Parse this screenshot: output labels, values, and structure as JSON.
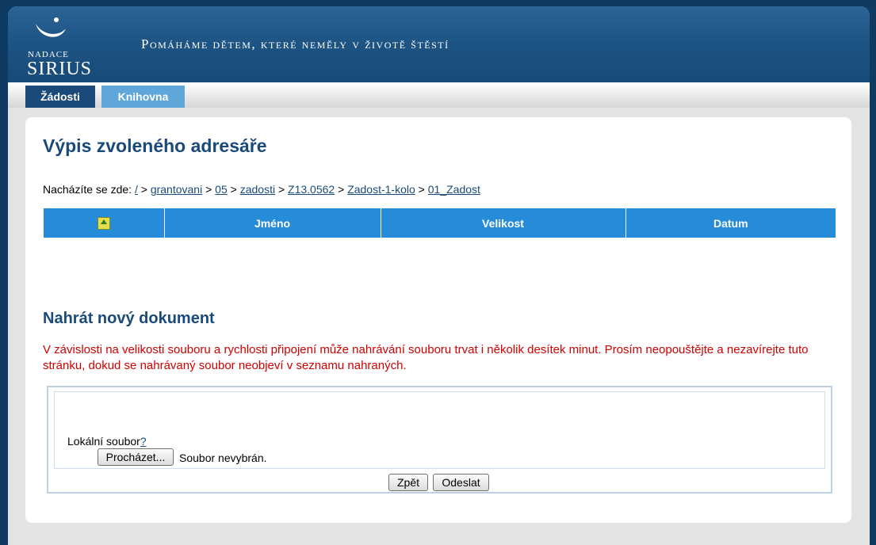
{
  "brand": {
    "logo_small": "NADACE",
    "logo_big": "SIRIUS",
    "tagline": "Pomáháme dětem, které neměly v životě štěstí"
  },
  "tabs": [
    {
      "label": "Žádosti",
      "active": true
    },
    {
      "label": "Knihovna",
      "active": false
    }
  ],
  "main": {
    "title": "Výpis zvoleného adresáře",
    "breadcrumb_prefix": "Nacházíte se zde:",
    "breadcrumb": [
      "/",
      "grantovani",
      "05",
      "zadosti",
      "Z13.0562",
      "Zadost-1-kolo",
      "01_Zadost"
    ],
    "breadcrumb_sep": ">"
  },
  "table": {
    "headers": [
      "Jméno",
      "Velikost",
      "Datum"
    ],
    "up_icon": "folder-up-icon",
    "rows": []
  },
  "upload": {
    "title": "Nahrát nový dokument",
    "warning": "V závislosti na velikosti souboru a rychlosti připojení může nahrávání souboru trvat i několik desítek minut. Prosím neopouštějte a nezavírejte tuto stránku, dokud se nahrávaný soubor neobjeví v seznamu nahraných.",
    "local_file_label": "Lokální soubor",
    "help_link": "?",
    "browse_label": "Procházet...",
    "no_file_text": "Soubor nevybrán.",
    "back_label": "Zpět",
    "submit_label": "Odeslat"
  },
  "colors": {
    "header": "#1e5585",
    "tab_active": "#1a4a7a",
    "tab_inactive": "#5fa6da",
    "table_header": "#268bd8",
    "warning": "#d40000"
  }
}
